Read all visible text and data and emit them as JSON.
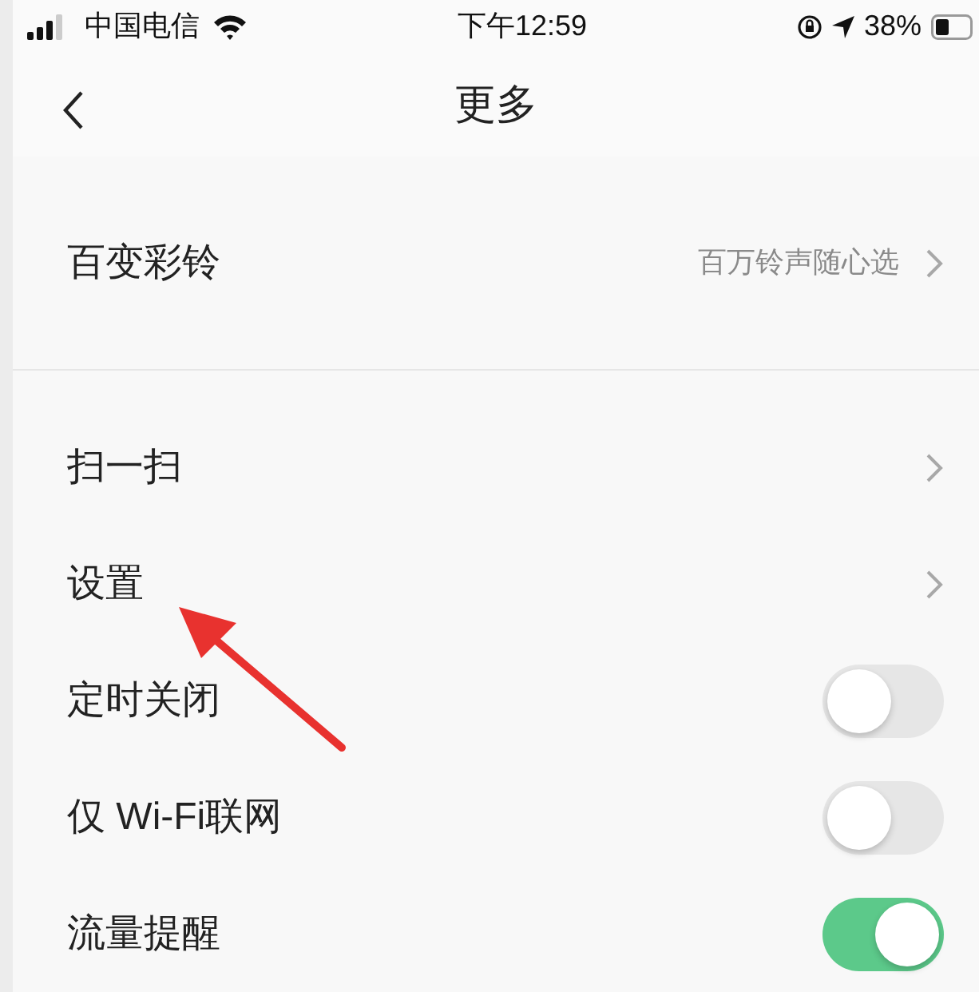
{
  "status_bar": {
    "carrier": "中国电信",
    "time": "下午12:59",
    "battery": "38%"
  },
  "nav": {
    "title": "更多"
  },
  "sections": [
    [
      {
        "kind": "link",
        "label": "百变彩铃",
        "detail": "百万铃声随心选"
      }
    ],
    [
      {
        "kind": "link",
        "label": "扫一扫"
      },
      {
        "kind": "link",
        "label": "设置"
      },
      {
        "kind": "toggle",
        "label": "定时关闭",
        "on": false
      },
      {
        "kind": "toggle",
        "label": "仅 Wi-Fi联网",
        "on": false
      },
      {
        "kind": "toggle",
        "label": "流量提醒",
        "on": true
      }
    ]
  ]
}
